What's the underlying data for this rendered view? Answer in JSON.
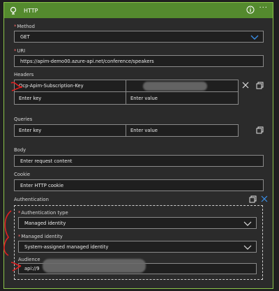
{
  "header": {
    "title": "HTTP"
  },
  "method": {
    "label": "Method",
    "value": "GET"
  },
  "uri": {
    "label": "URI",
    "value": "https://apim-demo00.azure-api.net/conference/speakers"
  },
  "headers": {
    "label": "Headers",
    "row1_key": "Ocp-Apim-Subscription-Key",
    "row2_key_placeholder": "Enter key",
    "row2_value_placeholder": "Enter value"
  },
  "queries": {
    "label": "Queries",
    "key_placeholder": "Enter key",
    "value_placeholder": "Enter value"
  },
  "body": {
    "label": "Body",
    "placeholder": "Enter request content"
  },
  "cookie": {
    "label": "Cookie",
    "placeholder": "Enter HTTP cookie"
  },
  "authentication": {
    "label": "Authentication",
    "type_label": "Authentication type",
    "type_value": "Managed identity",
    "identity_label": "Managed identity",
    "identity_value": "System-assigned managed identity",
    "audience_label": "Audience",
    "audience_value": "api://9"
  },
  "colors": {
    "accent": "#548a2e",
    "border": "#8bc34a",
    "dropdown_chevron": "#3a8ee6",
    "annotation": "#e02020"
  }
}
